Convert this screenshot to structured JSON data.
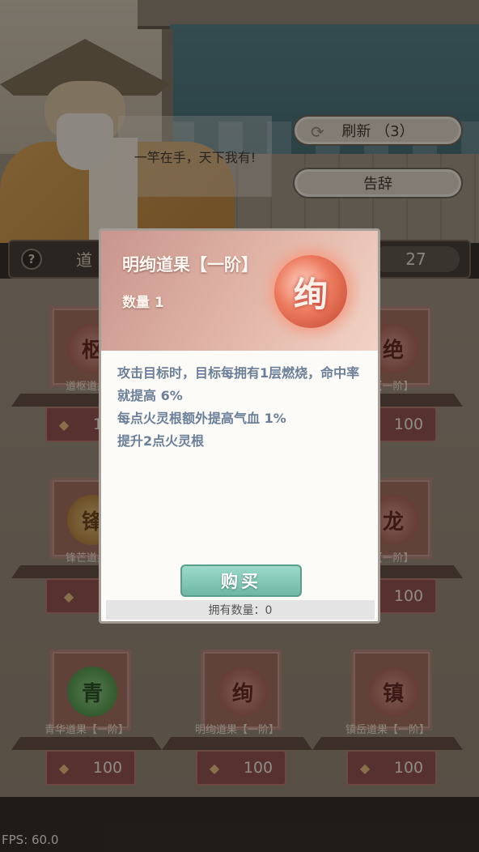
{
  "npc": {
    "speech": "一竿在手，天下我有!"
  },
  "actions": {
    "refresh_label": "刷新 （3）",
    "leave_label": "告辞"
  },
  "shop": {
    "title": "道",
    "currency_amount": "27",
    "help_icon": "?"
  },
  "items": [
    {
      "glyph": "枢",
      "name": "道枢道果",
      "price": "100",
      "orb": "rose"
    },
    {
      "glyph": "",
      "name": "",
      "price": "",
      "orb": "rose"
    },
    {
      "glyph": "绝",
      "name": "果【一阶】",
      "price": "100",
      "orb": "rose"
    },
    {
      "glyph": "锋",
      "name": "锋芒道果",
      "price": "1",
      "orb": "gold"
    },
    {
      "glyph": "",
      "name": "",
      "price": "",
      "orb": "rose"
    },
    {
      "glyph": "龙",
      "name": "果【一阶】",
      "price": "100",
      "orb": "rose"
    },
    {
      "glyph": "青",
      "name": "青华道果【一阶】",
      "price": "100",
      "orb": "green"
    },
    {
      "glyph": "绚",
      "name": "明绚道果【一阶】",
      "price": "100",
      "orb": "rose"
    },
    {
      "glyph": "镇",
      "name": "镇岳道果【一阶】",
      "price": "100",
      "orb": "rose"
    }
  ],
  "modal": {
    "title": "明绚道果【一阶】",
    "quantity": "数量 1",
    "orb_glyph": "绚",
    "description": [
      "攻击目标时，目标每拥有1层燃烧，命中率就提高 6%",
      "每点火灵根额外提高气血 1%",
      "提升2点火灵根"
    ],
    "buy_label": "购买",
    "owned_label": "拥有数量：0"
  },
  "fps": "FPS: 60.0",
  "icons": {
    "refresh": "refresh-icon",
    "coin": "coin-icon",
    "help": "help-icon"
  }
}
